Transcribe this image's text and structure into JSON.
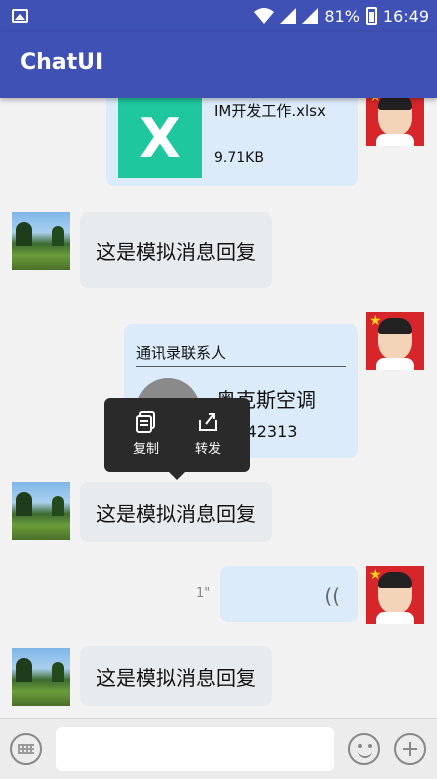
{
  "status_bar": {
    "battery": "81%",
    "time": "16:49"
  },
  "app_bar": {
    "title": "ChatUI"
  },
  "messages": {
    "file": {
      "icon_letter": "X",
      "file_name": "IM开发工作.xlsx",
      "file_size": "9.71KB"
    },
    "reply_1": "这是模拟消息回复",
    "contact": {
      "title": "通讯录联系人",
      "name": "奥克斯空调",
      "phone": "26142313"
    },
    "reply_2": "这是模拟消息回复",
    "voice": {
      "duration": "1\""
    },
    "reply_3": "这是模拟消息回复"
  },
  "context_menu": {
    "copy_label": "复制",
    "forward_label": "转发"
  },
  "input_bar": {
    "placeholder": ""
  },
  "colors": {
    "primary": "#3f51b5",
    "file_icon": "#1ec79d",
    "bubble_left": "#e8ebee",
    "bubble_right": "#dcebfa"
  }
}
